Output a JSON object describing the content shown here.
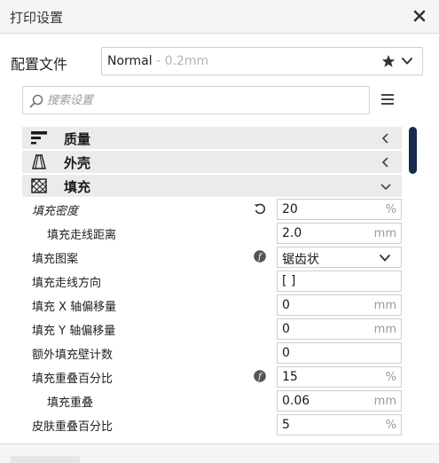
{
  "window": {
    "title": "打印设置"
  },
  "profile": {
    "label": "配置文件",
    "name": "Normal",
    "detail": " - 0.2mm"
  },
  "search": {
    "placeholder": "搜索设置"
  },
  "sections": [
    {
      "label": "质量",
      "icon": "quality-icon",
      "state": "collapsed"
    },
    {
      "label": "外壳",
      "icon": "shell-icon",
      "state": "collapsed"
    },
    {
      "label": "填充",
      "icon": "infill-icon",
      "state": "expanded"
    }
  ],
  "settings": [
    {
      "label": "填充密度",
      "value": "20",
      "unit": "%",
      "icon": "reset-icon",
      "indent": 1,
      "italic": true
    },
    {
      "label": "填充走线距离",
      "value": "2.0",
      "unit": "mm",
      "indent": 2
    },
    {
      "label": "填充图案",
      "value": "锯齿状",
      "unit": "",
      "icon": "function-icon",
      "indent": 1,
      "dropdown": true
    },
    {
      "label": "填充走线方向",
      "value": "[ ]",
      "unit": "",
      "indent": 1
    },
    {
      "label": "填充 X 轴偏移量",
      "value": "0",
      "unit": "mm",
      "indent": 1
    },
    {
      "label": "填充 Y 轴偏移量",
      "value": "0",
      "unit": "mm",
      "indent": 1
    },
    {
      "label": "额外填充壁计数",
      "value": "0",
      "unit": "",
      "indent": 1
    },
    {
      "label": "填充重叠百分比",
      "value": "15",
      "unit": "%",
      "icon": "function-icon",
      "indent": 1
    },
    {
      "label": "填充重叠",
      "value": "0.06",
      "unit": "mm",
      "indent": 2
    },
    {
      "label": "皮肤重叠百分比",
      "value": "5",
      "unit": "%",
      "indent": 1
    }
  ],
  "colors": {
    "accent": "#1a2a4f",
    "section_bg": "#ebebeb",
    "titlebar_bg": "#f5f5f5"
  }
}
